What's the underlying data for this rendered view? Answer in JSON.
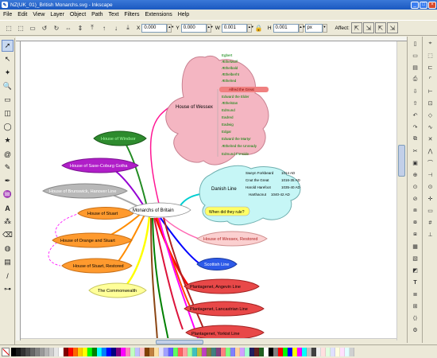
{
  "window": {
    "title": "NZ(UK_01)_British Monarchs.svg - Inkscape"
  },
  "menu": [
    "File",
    "Edit",
    "View",
    "Layer",
    "Object",
    "Path",
    "Text",
    "Filters",
    "Extensions",
    "Help"
  ],
  "controls": {
    "x_label": "X",
    "x_value": "0.000",
    "y_label": "Y",
    "y_value": "0.000",
    "w_label": "W",
    "w_value": "0.001",
    "h_label": "H",
    "h_value": "0.001",
    "unit": "px",
    "affect_label": "Affect:"
  },
  "mindmap": {
    "center": "Monarchs of Britain",
    "left_nodes": [
      "House of Windsor",
      "House of Saxe-Coburg Gotha",
      "House of Brunswick, Hanover Line",
      "House of Stuart",
      "House of Orange and Stuart",
      "House of Stuart, Restored",
      "The Commonwealth"
    ],
    "right_nodes": [
      "House of Wessex, Restored",
      "Scottish Line",
      "Plantagenet, Angevin Line",
      "Plantagenet, Lancastrian Line",
      "Plantagenet, Yorkist Line"
    ],
    "wessex": {
      "label": "House of Wessex",
      "kings": [
        "Egbert",
        "Æthelwulf",
        "Æthelbald",
        "Æthelberht",
        "Æthelred",
        "Alfred the Great",
        "Edward the Elder",
        "Æthelstan",
        "Edmund",
        "Eadred",
        "Eadwig",
        "Edgar",
        "Edward the Martyr",
        "Æthelred the Unready",
        "Edmund Ironside"
      ]
    },
    "danish": {
      "label": "Danish Line",
      "kings": [
        {
          "name": "Sweyn Forkbeard",
          "date": "1014 AD"
        },
        {
          "name": "Cnut the Great",
          "date": "1016-35 AD"
        },
        {
          "name": "Harold Harefoot",
          "date": "1035-40 AD"
        },
        {
          "name": "Harthacnut",
          "date": "1040-42 AD"
        }
      ],
      "question": "When did they rule?"
    }
  },
  "palette": [
    "#000000",
    "#1a1a1a",
    "#333333",
    "#4d4d4d",
    "#666666",
    "#808080",
    "#999999",
    "#b3b3b3",
    "#cccccc",
    "#e6e6e6",
    "#ffffff",
    "#800000",
    "#ff0000",
    "#ff6600",
    "#ffcc00",
    "#ffff00",
    "#00ff00",
    "#008000",
    "#00ffff",
    "#0080ff",
    "#0000ff",
    "#000080",
    "#800080",
    "#ff00ff",
    "#ff80c0",
    "#c0ffc0",
    "#c0c0ff",
    "#ffc0c0",
    "#804000",
    "#c08040",
    "#ffe0a0",
    "#e0e0ff",
    "#a0a0ff",
    "#6060ff",
    "#60ff60",
    "#ff6060",
    "#ffa0a0",
    "#a0ffa0",
    "#40c0c0",
    "#c0c040",
    "#c040c0",
    "#808040",
    "#408080",
    "#804080",
    "#ff8080",
    "#80ff80",
    "#8080ff",
    "#ffd0a0",
    "#d0a0ff",
    "#a0ffd0",
    "#202060",
    "#602020",
    "#206020",
    "#ffffff",
    "#000000",
    "#808080",
    "#ff0000",
    "#00ff00",
    "#0000ff",
    "#ffff00",
    "#ff00ff",
    "#00ffff",
    "#c0c0c0",
    "#404040",
    "#f0f0f0",
    "#ffe0e0",
    "#e0ffe0",
    "#e0e0ff",
    "#ffffe0",
    "#ffe0ff",
    "#e0ffff",
    "#d0d0d0"
  ]
}
